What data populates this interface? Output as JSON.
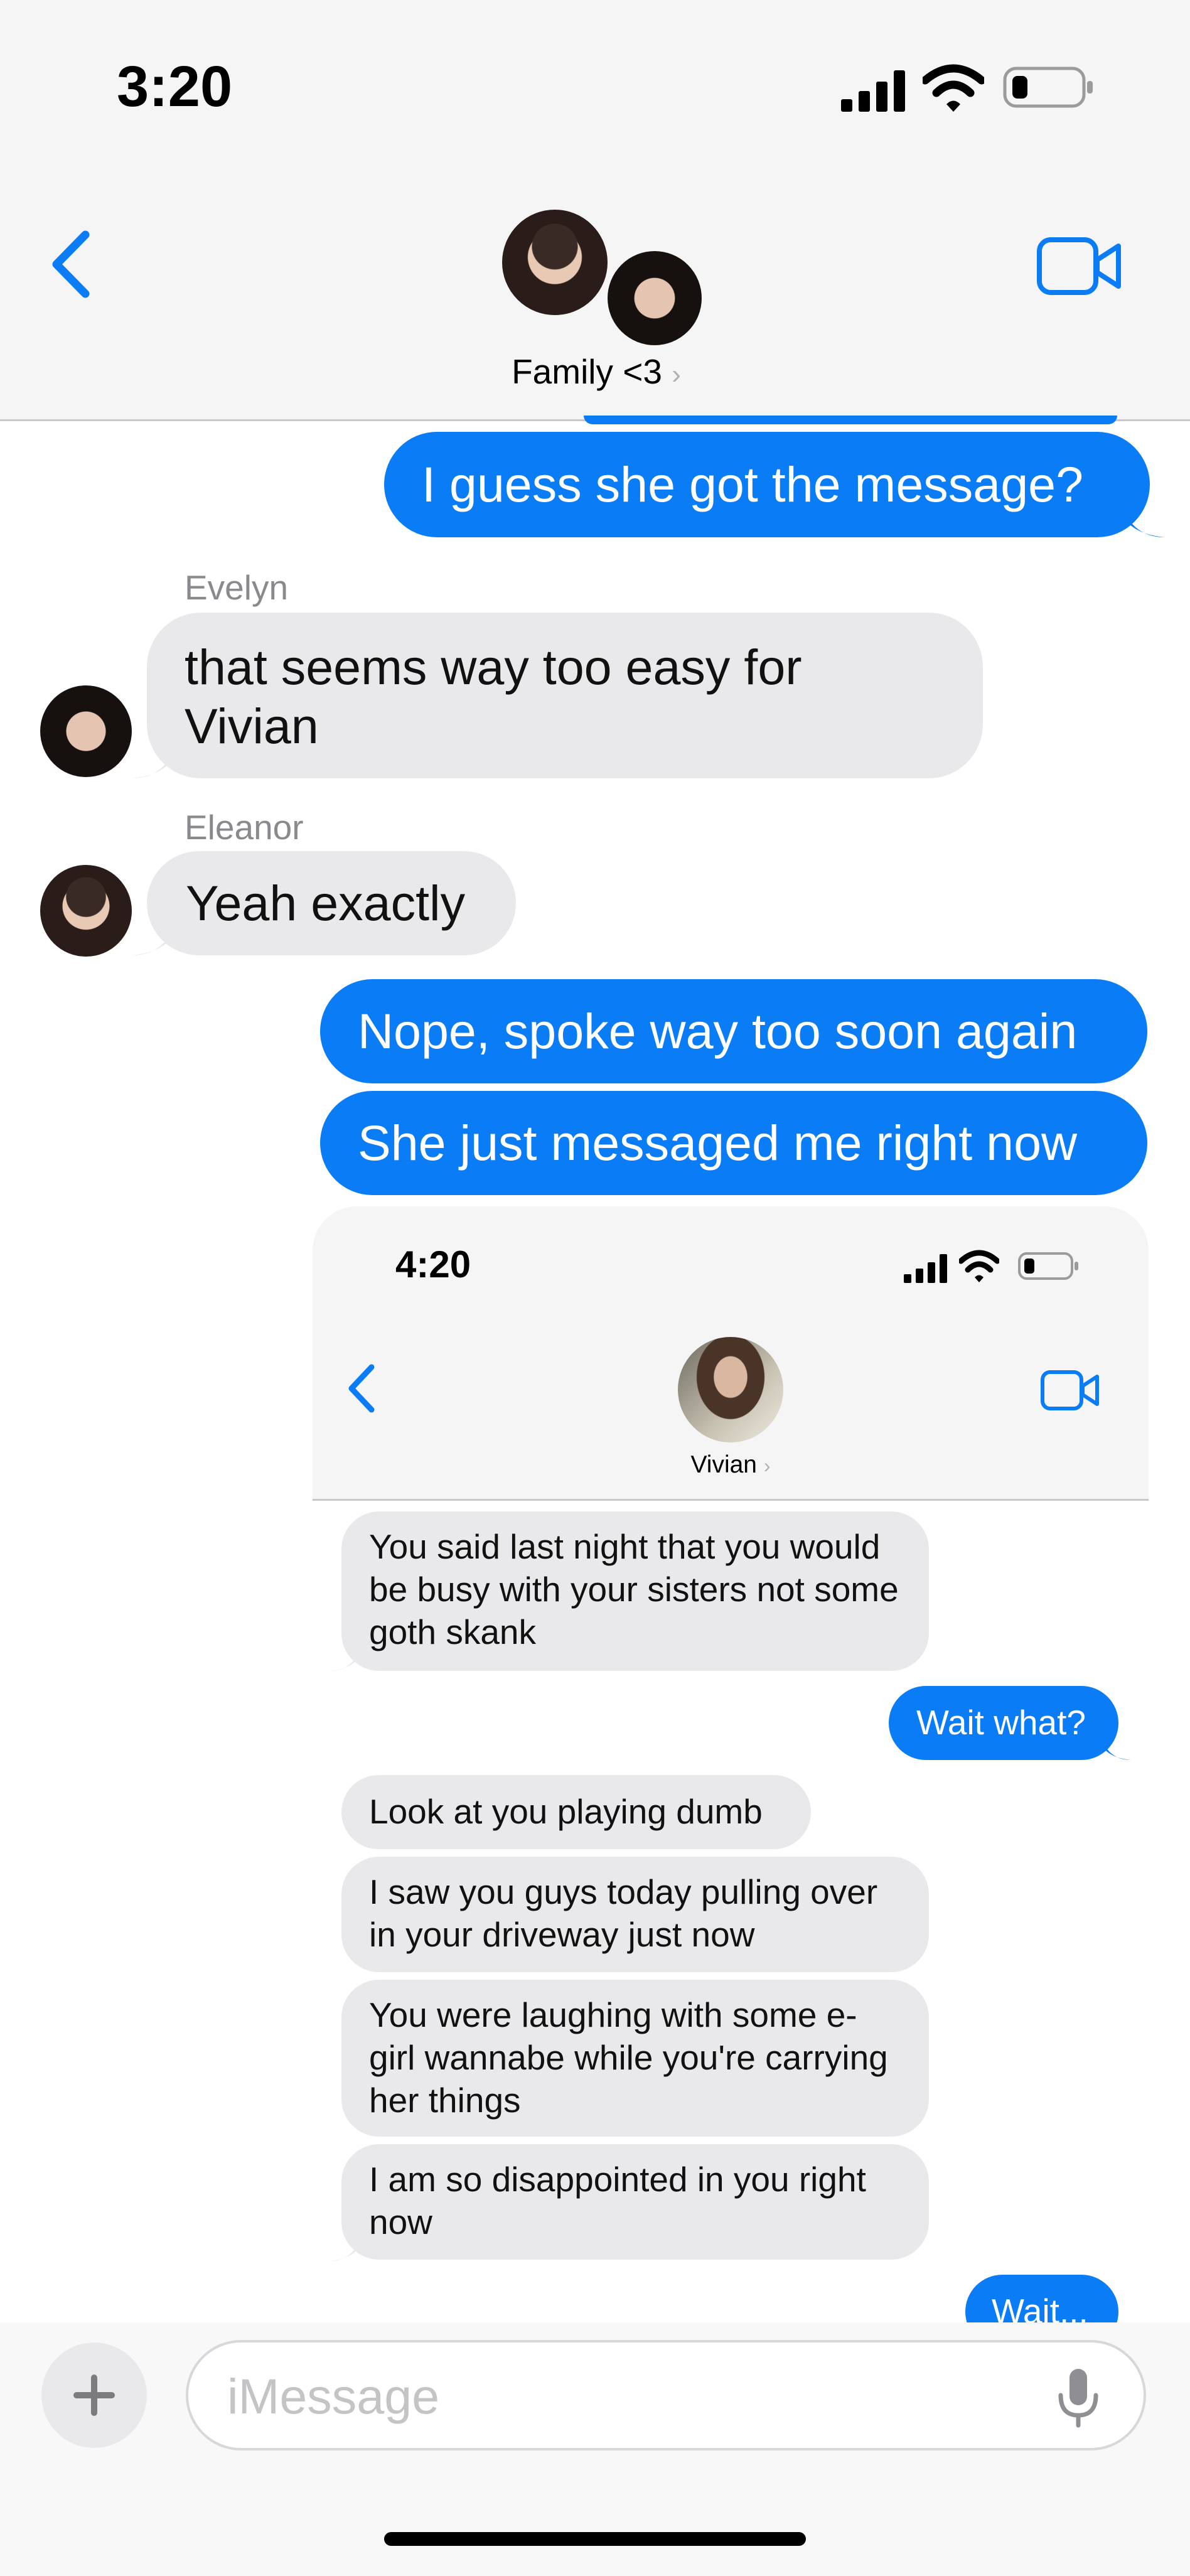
{
  "status_bar": {
    "time": "3:20"
  },
  "header": {
    "group_name": "Family <3",
    "back_icon": "chevron-left-icon",
    "video_icon": "video-camera-icon"
  },
  "messages": [
    {
      "type": "sent",
      "text": "I guess she got the message?"
    },
    {
      "type": "received",
      "sender": "Evelyn",
      "text": "that seems way too easy for Vivian"
    },
    {
      "type": "received",
      "sender": "Eleanor",
      "text": "Yeah exactly"
    },
    {
      "type": "sent",
      "text": "Nope, spoke way too soon again"
    },
    {
      "type": "sent",
      "text": "She just messaged me right now"
    }
  ],
  "screenshot": {
    "time": "4:20",
    "contact_name": "Vivian",
    "messages": [
      {
        "type": "received",
        "text": "You said last night that you would be busy with your sisters not some goth skank"
      },
      {
        "type": "sent",
        "text": "Wait what?"
      },
      {
        "type": "received",
        "text": "Look at you playing dumb"
      },
      {
        "type": "received",
        "text": "I saw you guys today pulling over in your driveway just now"
      },
      {
        "type": "received",
        "text": "You were laughing with some e-girl wannabe while you're carrying her things"
      },
      {
        "type": "received",
        "text": "I am so disappointed in you right now"
      },
      {
        "type": "sent",
        "text": "Wait..."
      }
    ]
  },
  "composer": {
    "placeholder": "iMessage",
    "plus_icon": "plus-icon",
    "mic_icon": "microphone-icon"
  },
  "colors": {
    "accent": "#0a7cf6",
    "received_bubble": "#e9e9eb",
    "header_bg": "#f5f5f5"
  }
}
